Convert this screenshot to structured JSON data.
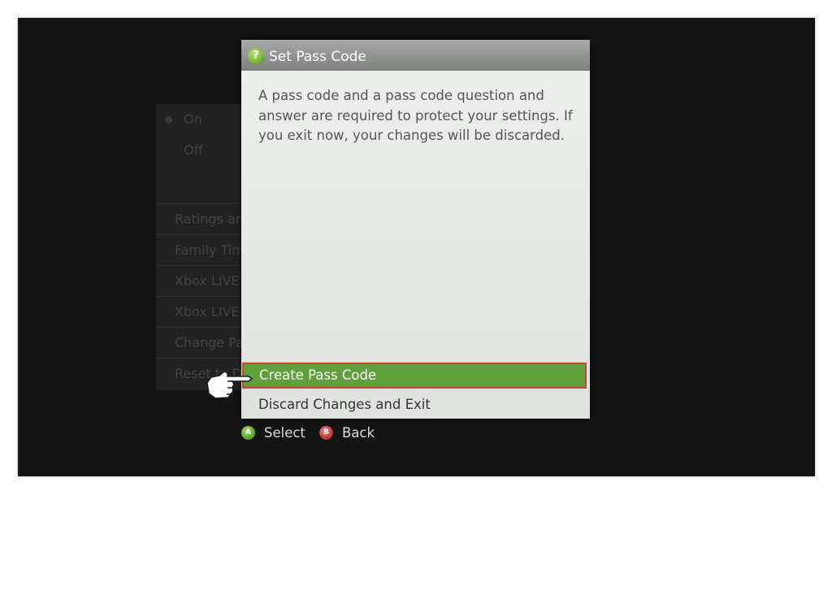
{
  "background_menu": {
    "radio_options": [
      {
        "label": "On",
        "selected": true
      },
      {
        "label": "Off",
        "selected": false
      }
    ],
    "items": [
      "Ratings and",
      "Family Time",
      "Xbox LIVE A",
      "Xbox LIVE M",
      "Change Pas",
      "Reset to De"
    ]
  },
  "dialog": {
    "title": "Set Pass Code",
    "icon": "help-icon",
    "message": "A pass code and a pass code question and answer are required to protect your settings. If you exit now, your changes will be discarded.",
    "options": [
      {
        "label": "Create Pass Code",
        "selected": true
      },
      {
        "label": "Discard Changes and Exit",
        "selected": false
      }
    ]
  },
  "footer": {
    "select": {
      "glyph": "A",
      "label": "Select",
      "color": "#5c9d2a"
    },
    "back": {
      "glyph": "B",
      "label": "Back",
      "color": "#b52f2c"
    }
  },
  "colors": {
    "highlight": "#5fa03a",
    "highlight_border": "#c9452e"
  }
}
